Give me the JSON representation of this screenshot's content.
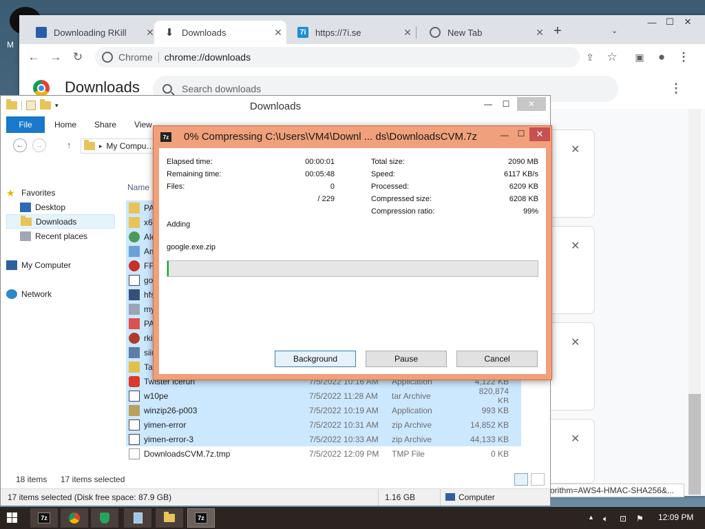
{
  "desktop": {
    "icon_label": "M"
  },
  "chrome": {
    "tabs": [
      {
        "label": "Downloading RKill",
        "close": "✕"
      },
      {
        "label": "Downloads",
        "close": "✕"
      },
      {
        "label": "https://7i.se",
        "close": "✕"
      },
      {
        "label": "New Tab",
        "close": "✕"
      }
    ],
    "tab_favicon_7i": "7i",
    "new_tab": "+",
    "omnibox_chip": "Chrome",
    "omnibox_url": "chrome://downloads",
    "page_title": "Downloads",
    "search_placeholder": "Search downloads",
    "url_snippet": "orithm=AWS4-HMAC-SHA256&...",
    "card_close": "✕"
  },
  "explorer": {
    "title": "Downloads",
    "ribbon_tabs": [
      "File",
      "Home",
      "Share",
      "View"
    ],
    "address": "My Computer",
    "nav": {
      "favorites": "Favorites",
      "desktop": "Desktop",
      "downloads": "Downloads",
      "recent": "Recent places",
      "computer": "My Computer",
      "network": "Network"
    },
    "column_name": "Name",
    "files": [
      {
        "name": "PA",
        "date": "",
        "type": "",
        "size": ""
      },
      {
        "name": "x64",
        "date": "",
        "type": "",
        "size": ""
      },
      {
        "name": "Ale",
        "date": "",
        "type": "",
        "size": ""
      },
      {
        "name": "Am",
        "date": "",
        "type": "",
        "size": ""
      },
      {
        "name": "FFA",
        "date": "",
        "type": "",
        "size": ""
      },
      {
        "name": "goo",
        "date": "",
        "type": "",
        "size": ""
      },
      {
        "name": "hfs",
        "date": "",
        "type": "",
        "size": ""
      },
      {
        "name": "my",
        "date": "",
        "type": "",
        "size": ""
      },
      {
        "name": "PA",
        "date": "",
        "type": "",
        "size": ""
      },
      {
        "name": "rkil",
        "date": "",
        "type": "",
        "size": ""
      },
      {
        "name": "siin",
        "date": "",
        "type": "",
        "size": ""
      },
      {
        "name": "Tas",
        "date": "",
        "type": "",
        "size": ""
      },
      {
        "name": "Twister icerun",
        "date": "7/5/2022 10:16 AM",
        "type": "Application",
        "size": "4,122 KB"
      },
      {
        "name": "w10pe",
        "date": "7/5/2022 11:28 AM",
        "type": "tar Archive",
        "size": "820,874 KB"
      },
      {
        "name": "winzip26-p003",
        "date": "7/5/2022 10:19 AM",
        "type": "Application",
        "size": "993 KB"
      },
      {
        "name": "yimen-error",
        "date": "7/5/2022 10:31 AM",
        "type": "zip Archive",
        "size": "14,852 KB"
      },
      {
        "name": "yimen-error-3",
        "date": "7/5/2022 10:33 AM",
        "type": "zip Archive",
        "size": "44,133 KB"
      },
      {
        "name": "DownloadsCVM.7z.tmp",
        "date": "7/5/2022 12:09 PM",
        "type": "TMP File",
        "size": "0 KB"
      }
    ],
    "status_items": "18 items",
    "status_selected": "17 items selected",
    "details_text": "17 items selected (Disk free space: 87.9 GB)",
    "details_size": "1.16 GB",
    "details_location": "Computer"
  },
  "zip": {
    "title": "0% Compressing C:\\Users\\VM4\\Downl ... ds\\DownloadsCVM.7z",
    "percent": 0,
    "left_stats": [
      {
        "label": "Elapsed time:",
        "value": "00:00:01"
      },
      {
        "label": "Remaining time:",
        "value": "00:05:48"
      },
      {
        "label": "Files:",
        "value": "0"
      },
      {
        "label": "",
        "value": "/ 229"
      }
    ],
    "right_stats": [
      {
        "label": "Total size:",
        "value": "2090 MB"
      },
      {
        "label": "Speed:",
        "value": "6117 KB/s"
      },
      {
        "label": "Processed:",
        "value": "6209 KB"
      },
      {
        "label": "Compressed size:",
        "value": "6208 KB"
      },
      {
        "label": "Compression ratio:",
        "value": "99%"
      }
    ],
    "action": "Adding",
    "current_file": "google.exe.zip",
    "buttons": {
      "background": "Background",
      "pause": "Pause",
      "cancel": "Cancel"
    },
    "logo_text": "7z"
  },
  "taskbar": {
    "apps": [
      "7z",
      "chrome",
      "shield",
      "notepad",
      "explorer",
      "7z"
    ],
    "app_7z_label": "7z",
    "time": "12:09 PM"
  },
  "colors": {
    "zip_frame": "#f0a07a",
    "progress_fill": "#06b025",
    "explorer_file_tab": "#1979ca"
  }
}
